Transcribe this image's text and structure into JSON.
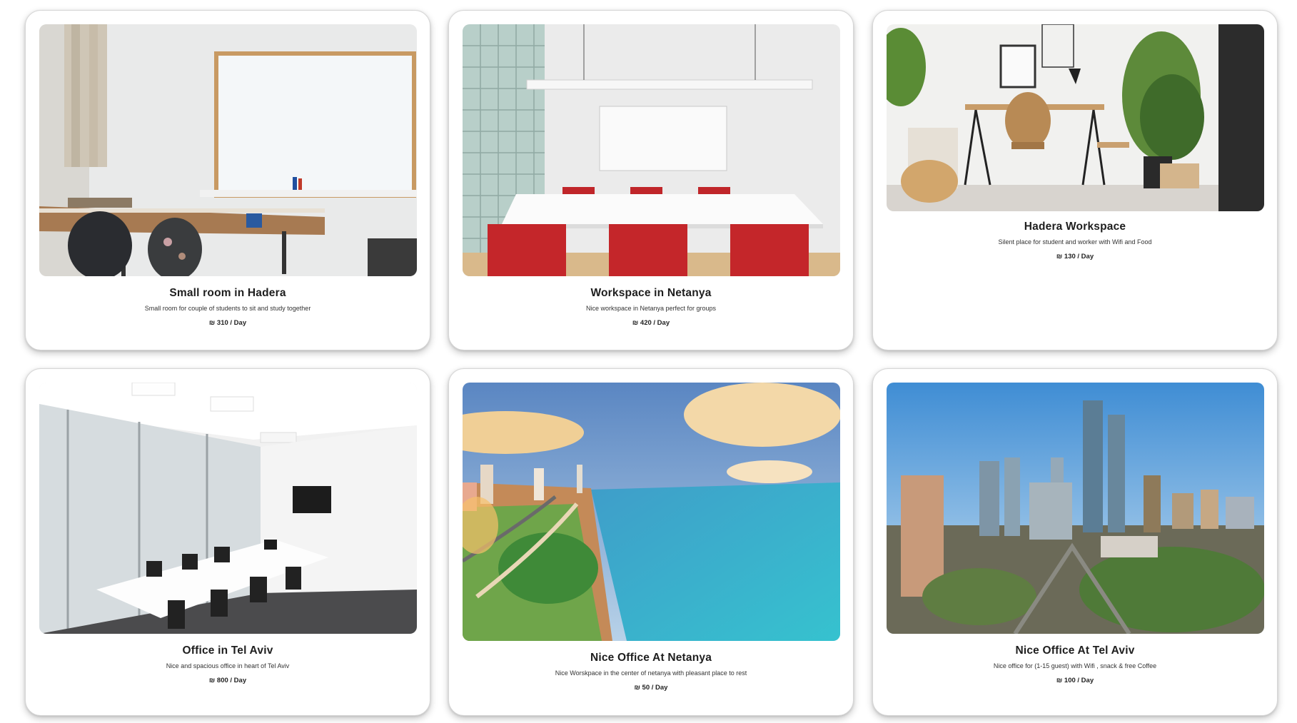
{
  "listings": [
    {
      "title": "Small room in Hadera",
      "description": "Small room for couple of students to sit and study together",
      "price": "₪ 310 / Day",
      "image": "classroom-whiteboard-photo"
    },
    {
      "title": "Workspace in Netanya",
      "description": "Nice workspace in Netanya perfect for groups",
      "price": "₪ 420 / Day",
      "image": "meeting-room-red-chairs-photo"
    },
    {
      "title": "Hadera Workspace",
      "description": "Silent place for student and worker with Wifi and Food",
      "price": "₪ 130 / Day",
      "image": "desk-with-plants-photo"
    },
    {
      "title": "Office in Tel Aviv",
      "description": "Nice and spacious office in heart of Tel Aviv",
      "price": "₪ 800 / Day",
      "image": "conference-room-photo"
    },
    {
      "title": "Nice Office At Netanya",
      "description": "Nice Worskpace in the center of netanya with pleasant place to rest",
      "price": "₪ 50 / Day",
      "image": "netanya-coastline-photo"
    },
    {
      "title": "Nice Office At Tel Aviv",
      "description": "Nice office for (1-15 guest) with Wifi , snack & free Coffee",
      "price": "₪ 100 / Day",
      "image": "city-skyline-photo"
    }
  ]
}
